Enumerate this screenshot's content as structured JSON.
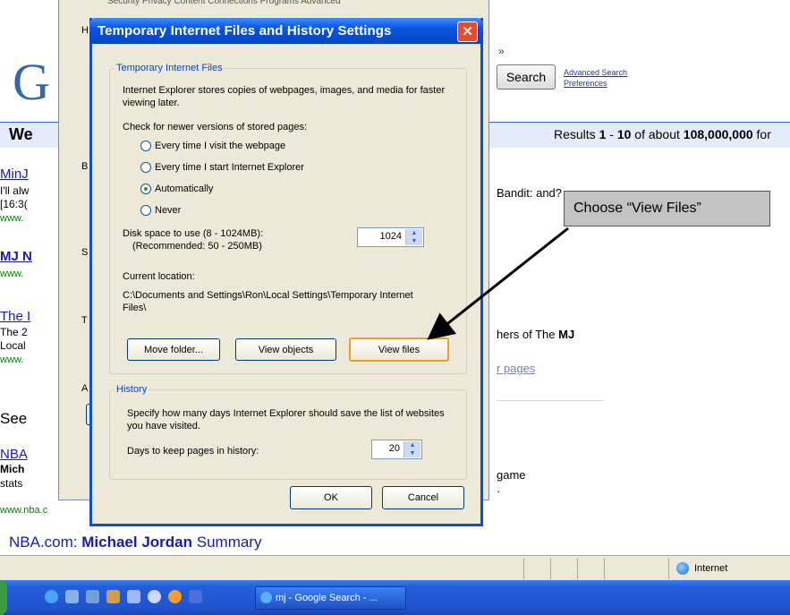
{
  "background_page": {
    "logo": "G",
    "search_button": "Search",
    "top_link": "»",
    "advanced_search": "Advanced Search",
    "preferences": "Preferences",
    "web_label": "We",
    "results_prefix": "Results ",
    "results_range_a": "1",
    "results_dash": " - ",
    "results_range_b": "10",
    "results_mid": " of about ",
    "results_total": "108,000,000",
    "results_suffix": " for",
    "results": [
      {
        "title": "MinJ",
        "text1": "I'll alw",
        "text2": "[16:3(",
        "url": "www.",
        "right_text": "Bandit: and?"
      },
      {
        "title": "MJ N",
        "url": "www."
      },
      {
        "title": "The I",
        "text1": "The 2",
        "text2": "Local",
        "url": "www.",
        "right_text_pre": "hers of The ",
        "right_text_bold": "MJ",
        "right_link": "r pages"
      }
    ],
    "see_label": "See",
    "nba_title": "NBA",
    "nba_bold": "Mich",
    "nba_text": "stats",
    "nba_url": "www.nba.c",
    "nba_right": "game",
    "bottom_title_pre": "NBA.com: ",
    "bottom_title_bold": "Michael Jordan",
    "bottom_title_post": " Summary",
    "io_tabs": "Security  Privacy  Content  Connections  Programs  Advanced",
    "io_letters": [
      "H",
      "B",
      "S",
      "T",
      "A"
    ]
  },
  "dialog": {
    "title": "Temporary Internet Files and History Settings",
    "close_symbol": "✕",
    "tif_group": {
      "legend": "Temporary Internet Files",
      "description": "Internet Explorer stores copies of webpages, images, and media for faster viewing later.",
      "check_label": "Check for newer versions of stored pages:",
      "options": [
        {
          "label": "Every time I visit the webpage",
          "selected": false
        },
        {
          "label": "Every time I start Internet Explorer",
          "selected": false
        },
        {
          "label": "Automatically",
          "selected": true
        },
        {
          "label": "Never",
          "selected": false
        }
      ],
      "disk_label": "Disk space to use (8 - 1024MB):",
      "disk_recommended": "(Recommended: 50 - 250MB)",
      "disk_value": "1024",
      "location_label": "Current location:",
      "location_path": "C:\\Documents and Settings\\Ron\\Local Settings\\Temporary Internet Files\\",
      "move_folder": "Move folder...",
      "view_objects": "View objects",
      "view_files": "View files"
    },
    "history_group": {
      "legend": "History",
      "description": "Specify how many days Internet Explorer should save the list of websites you have visited.",
      "days_label": "Days to keep pages in history:",
      "days_value": "20"
    },
    "ok": "OK",
    "cancel": "Cancel"
  },
  "callout": {
    "text": "Choose “View Files”"
  },
  "spinner_arrows": {
    "up": "▲",
    "down": "▼"
  },
  "statusbar": {
    "zone": "Internet"
  },
  "taskbar": {
    "window_button": "mj - Google Search - ..."
  },
  "colors": {
    "dialog_title": "#0a55e0",
    "taskbar": "#245edb",
    "legend": "#0046d5",
    "focus_border": "#e5a228",
    "callout_bg": "#c2c2c2"
  }
}
